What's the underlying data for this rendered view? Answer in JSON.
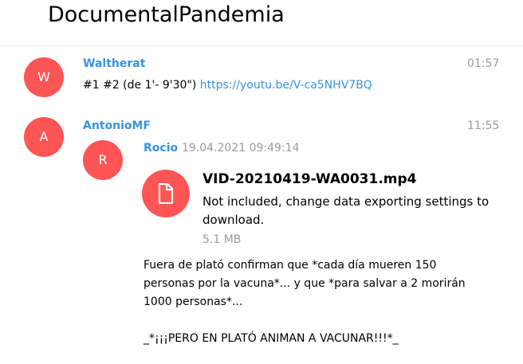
{
  "header": {
    "title": "DocumentalPandemia"
  },
  "messages": [
    {
      "avatar_letter": "W",
      "from": "Waltherat",
      "time": "01:57",
      "text_prefix": "#1 #2 (de 1'- 9'30\") ",
      "link": "https://youtu.be/V-ca5NHV7BQ"
    },
    {
      "avatar_letter": "A",
      "from": "AntonioMF",
      "time": "11:55",
      "forwarded": {
        "avatar_letter": "R",
        "from": "Rocio",
        "date": "19.04.2021 09:49:14",
        "file": {
          "icon": "file-icon",
          "title": "VID-20210419-WA0031.mp4",
          "status": "Not included, change data exporting settings to download.",
          "size": "5.1 MB"
        },
        "text_lines": [
          "Fuera de plató confirman que *cada día mueren 150",
          "personas por la vacuna*... y que *para salvar a 2 morirán",
          "1000 personas*...",
          "_*¡¡¡PERO EN PLATÓ ANIMAN A VACUNAR!!!*_"
        ]
      }
    }
  ],
  "colors": {
    "accent": "#3892db",
    "avatar": "#ff5555",
    "muted": "#999999"
  }
}
